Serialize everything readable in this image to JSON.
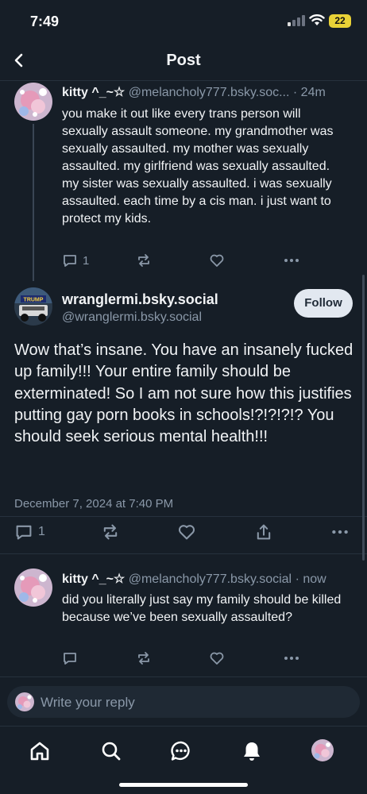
{
  "status_bar": {
    "time": "7:49",
    "battery": "22"
  },
  "header": {
    "title": "Post"
  },
  "parent_post": {
    "display_name": "kitty ^_~☆",
    "handle": "@melancholy777.bsky.soc...",
    "timestamp": "· 24m",
    "text": "you make it out like every trans person will sexually assault someone. my grandmother was sexually assaulted. my mother was sexually assaulted. my girlfriend was sexually assaulted. my sister was sexually assaulted. i was sexually assaulted. each time by a cis man. i just want to protect my kids.",
    "reply_count": "1"
  },
  "main_post": {
    "display_name": "wranglermi.bsky.social",
    "handle": "@wranglermi.bsky.social",
    "follow_label": "Follow",
    "avatar_text": "TRUMP",
    "text": "Wow that’s insane. You have an insanely fucked up family!!! Your entire family should be exterminated! So I am not sure how this justifies putting gay porn books in schools!?!?!?!? You should seek serious mental health!!!",
    "date": "December 7, 2024 at 7:40 PM",
    "reply_count": "1"
  },
  "reply_post": {
    "display_name": "kitty ^_~☆",
    "handle": "@melancholy777.bsky.social",
    "timestamp": "· now",
    "text": "did you literally just say my family should be killed because we’ve been sexually assaulted?"
  },
  "composer": {
    "placeholder": "Write your reply"
  },
  "tabs": [
    "home-icon",
    "search-icon",
    "chat-icon",
    "bell-icon",
    "profile-avatar"
  ],
  "colors": {
    "background": "#161e27",
    "muted": "#8a98a8",
    "battery": "#e9d237"
  }
}
